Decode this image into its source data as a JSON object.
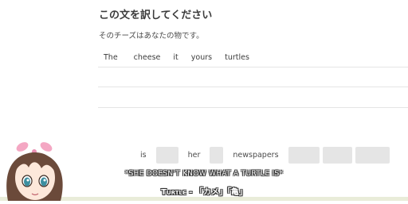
{
  "exercise": {
    "title": "この文を訳してください",
    "sentence": "そのチーズはあなたの物です。"
  },
  "answer_words": [
    "The",
    "cheese",
    "it",
    "yours",
    "turtles"
  ],
  "word_bank": [
    "is",
    "her",
    "newspapers"
  ],
  "subtitles": {
    "line1": "*she doesn't know what a turtle is*",
    "line2_term": "Turtle",
    "line2_sep": " - ",
    "line2_kana": "「カメ」",
    "line2_kanji": "「亀」"
  },
  "colors": {
    "slot": "#e5e5e5",
    "divider": "#e5e5e5",
    "hair": "#6b4a3a",
    "bow": "#f4a7c3"
  }
}
